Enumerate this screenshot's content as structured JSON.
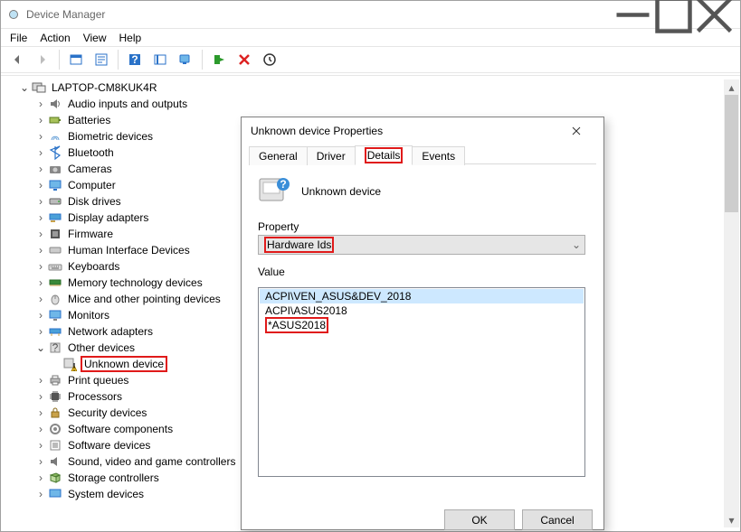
{
  "window": {
    "title": "Device Manager",
    "menus": {
      "file": "File",
      "action": "Action",
      "view": "View",
      "help": "Help"
    }
  },
  "toolbar": {
    "back": "Back",
    "forward": "Forward",
    "showhidden": "Show hidden",
    "properties": "Properties",
    "help": "Help",
    "scan": "Scan for hardware changes",
    "monitor": "Update driver",
    "add": "Add legacy hardware",
    "uninstall": "Uninstall device",
    "events": "View events"
  },
  "tree": {
    "root": "LAPTOP-CM8KUK4R",
    "nodes": [
      "Audio inputs and outputs",
      "Batteries",
      "Biometric devices",
      "Bluetooth",
      "Cameras",
      "Computer",
      "Disk drives",
      "Display adapters",
      "Firmware",
      "Human Interface Devices",
      "Keyboards",
      "Memory technology devices",
      "Mice and other pointing devices",
      "Monitors",
      "Network adapters",
      "Other devices",
      "Print queues",
      "Processors",
      "Security devices",
      "Software components",
      "Software devices",
      "Sound, video and game controllers",
      "Storage controllers",
      "System devices"
    ],
    "unknown_device": "Unknown device"
  },
  "dialog": {
    "title": "Unknown device Properties",
    "tabs": {
      "general": "General",
      "driver": "Driver",
      "details": "Details",
      "events": "Events"
    },
    "device_name": "Unknown device",
    "property_label": "Property",
    "property_value": "Hardware Ids",
    "value_label": "Value",
    "values": [
      "ACPI\\VEN_ASUS&DEV_2018",
      "ACPI\\ASUS2018",
      "*ASUS2018"
    ],
    "ok": "OK",
    "cancel": "Cancel"
  }
}
